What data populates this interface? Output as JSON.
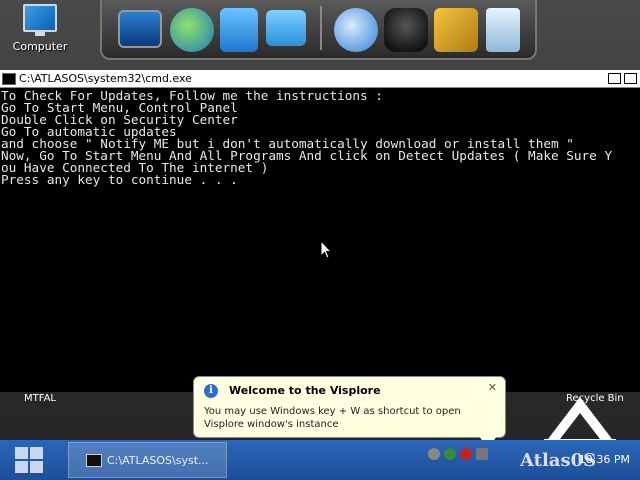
{
  "desktop": {
    "icon_computer_label": "Computer",
    "left_label": "MTFAL",
    "right_label": "Recycle Bin"
  },
  "dock": {
    "items": [
      "monitor",
      "network-globe",
      "documents",
      "control-panel",
      "browser-globe",
      "shirt",
      "tools",
      "recycle-bin"
    ]
  },
  "cmd": {
    "title": "C:\\ATLASOS\\system32\\cmd.exe",
    "lines": [
      "To Check For Updates, Follow me the instructions :",
      "Go To Start Menu, Control Panel",
      "Double Click on Security Center",
      "Go To automatic updates",
      "and choose \" Notify ME but i don't automatically download or install them \"",
      "Now, Go To Start Menu And All Programs And click on Detect Updates ( Make Sure Y",
      "ou Have Connected To The internet )",
      "Press any key to continue . . ."
    ]
  },
  "balloon": {
    "title": "Welcome to the Visplore",
    "message": "You may use Windows key + W as shortcut to open Visplore window's instance",
    "close": "✕"
  },
  "taskbar": {
    "task_label": "C:\\ATLASOS\\syst...",
    "brand": "Atlas0S",
    "clock": "10:36 PM"
  },
  "colors": {
    "taskbar": "#2c66b8",
    "console_bg": "#000000",
    "balloon_bg": "#ffffe1"
  }
}
